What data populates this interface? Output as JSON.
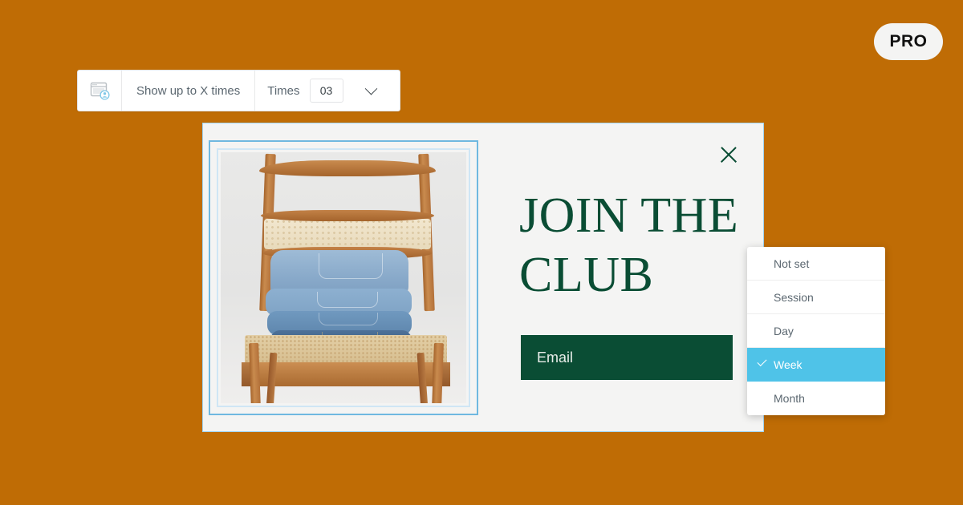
{
  "background_color": "#bf6c05",
  "badge": {
    "label": "PRO"
  },
  "toolbar": {
    "icon": "popup-window-user-icon",
    "rule_label": "Show up to X times",
    "field_label": "Times",
    "times_value": "03",
    "chevron": "chevron-down-icon"
  },
  "popup": {
    "close_icon": "close-icon",
    "headline": "JOIN THE CLUB",
    "email_placeholder": "Email",
    "image_alt": "Stack of folded blue denim jeans on a wooden folding chair with cane back and seat",
    "accent_green": "#0a4d34",
    "selection_border": "#6fb8e0",
    "surface": "#f4f4f3"
  },
  "dropdown": {
    "highlight_color": "#4fc3e8",
    "selected": "Week",
    "items": [
      {
        "label": "Not set",
        "selected": false
      },
      {
        "label": "Session",
        "selected": false
      },
      {
        "label": "Day",
        "selected": false
      },
      {
        "label": "Week",
        "selected": true
      },
      {
        "label": "Month",
        "selected": false
      }
    ]
  }
}
